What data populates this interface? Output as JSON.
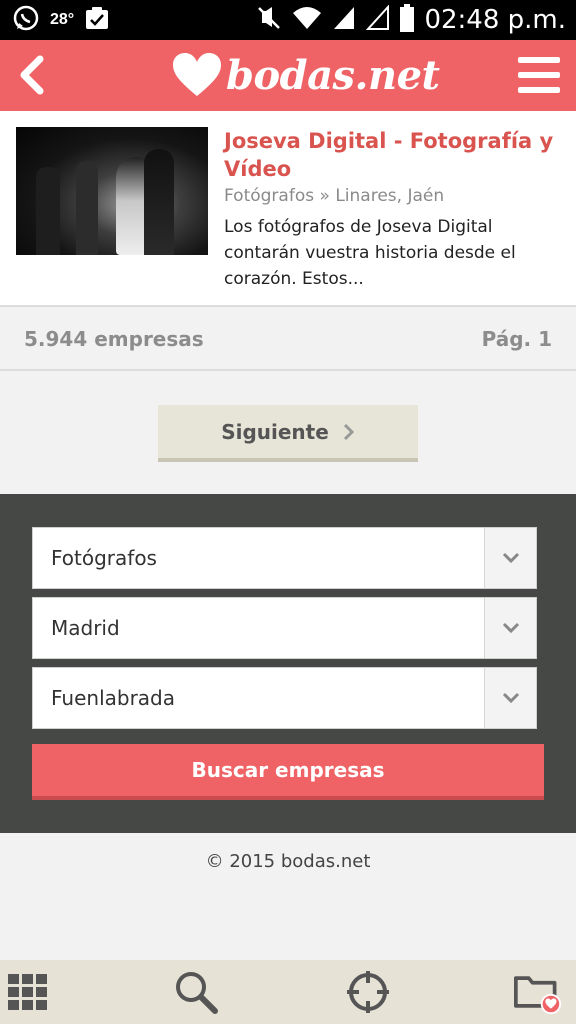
{
  "status_bar": {
    "temperature": "28°",
    "time": "02:48 p.m."
  },
  "app_bar": {
    "logo_text": "bodas.net"
  },
  "listing": {
    "title": "Joseva Digital - Fotografía y Vídeo",
    "category": "Fotógrafos",
    "separator": "»",
    "location": "Linares, Jaén",
    "description": "Los fotógrafos de Joseva Digital contarán vuestra historia desde el corazón. Estos..."
  },
  "results": {
    "count": "5.944 empresas",
    "page": "Pág. 1"
  },
  "pagination": {
    "next_label": "Siguiente"
  },
  "search": {
    "category_value": "Fotógrafos",
    "region_value": "Madrid",
    "city_value": "Fuenlabrada",
    "submit_label": "Buscar empresas"
  },
  "footer": {
    "copyright": "© 2015 bodas.net"
  },
  "bottom_nav": {
    "items": [
      "grid-icon",
      "search-icon",
      "crosshair-icon",
      "favorites-folder-icon"
    ]
  },
  "colors": {
    "brand": "#ef6366",
    "title_red": "#d9534f",
    "panel_dark": "#464845",
    "button_beige": "#e7e4d8"
  }
}
